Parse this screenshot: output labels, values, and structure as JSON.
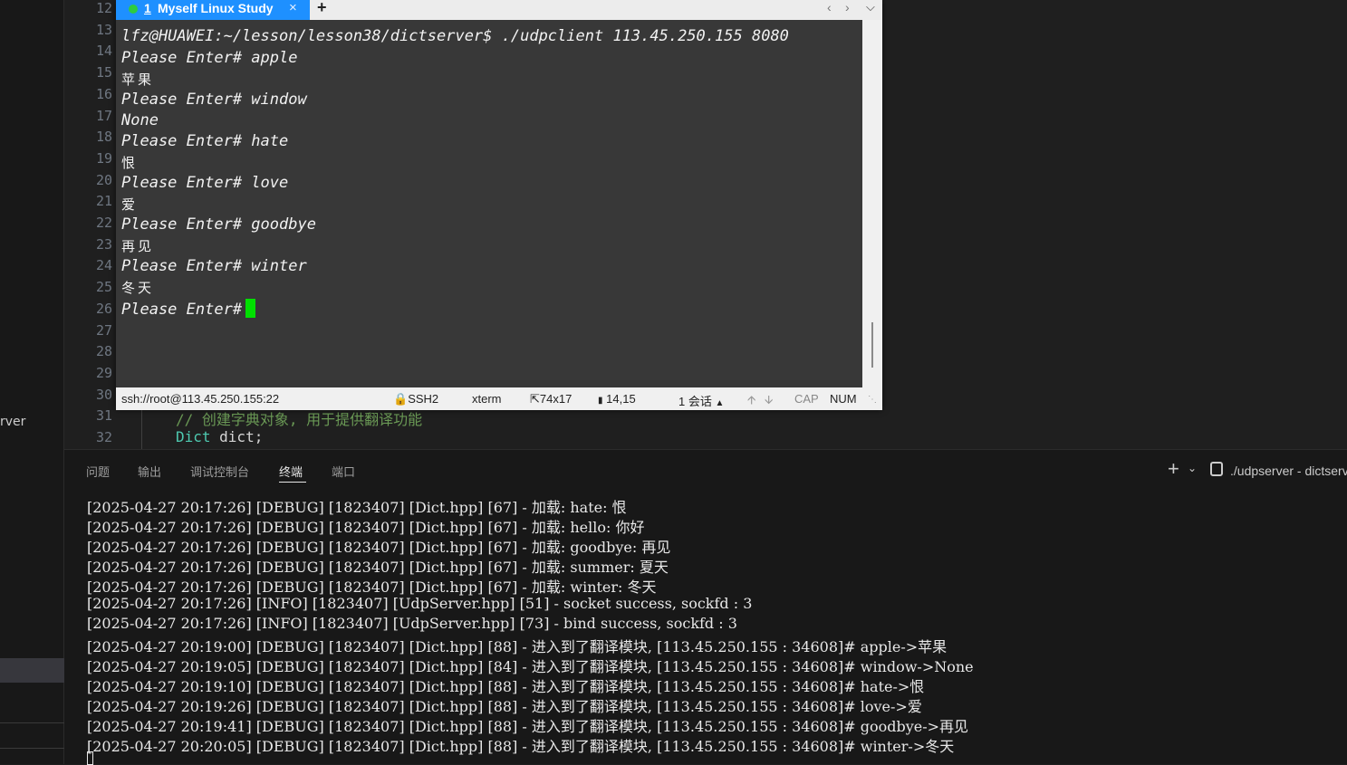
{
  "sidebar": {
    "partial_label": "rver"
  },
  "editor": {
    "line_numbers": [
      "12",
      "13",
      "14",
      "15",
      "16",
      "17",
      "18",
      "19",
      "20",
      "21",
      "22",
      "23",
      "24",
      "25",
      "26",
      "27",
      "28",
      "29",
      "30",
      "31",
      "32"
    ],
    "code": {
      "comment": "// 创建字典对象, 用于提供翻译功能",
      "type_name": "Dict",
      "var_decl": " dict;",
      "comment_color": "#6a9955",
      "type_color": "#4ec9b0",
      "text_color": "#d4d4d4"
    }
  },
  "xshell": {
    "tab": {
      "number": "1",
      "title": "Myself Linux Study",
      "close": "×",
      "add": "+",
      "status_color": "#2ecc40",
      "accent": "#1e90ff"
    },
    "nav": {
      "left": "‹",
      "right": "›",
      "menu": "⌵"
    },
    "terminal": {
      "prompt_line": "lfz@HUAWEI:~/lesson/lesson38/dictserver$ ./udpclient 113.45.250.155 8080",
      "lines": [
        {
          "kind": "input",
          "text": "Please Enter# apple"
        },
        {
          "kind": "output",
          "text": "苹果"
        },
        {
          "kind": "input",
          "text": "Please Enter# window"
        },
        {
          "kind": "input",
          "text": "None"
        },
        {
          "kind": "input",
          "text": "Please Enter# hate"
        },
        {
          "kind": "output",
          "text": "恨"
        },
        {
          "kind": "input",
          "text": "Please Enter# love"
        },
        {
          "kind": "output",
          "text": "爱"
        },
        {
          "kind": "input",
          "text": "Please Enter# goodbye"
        },
        {
          "kind": "output",
          "text": "再见"
        },
        {
          "kind": "input",
          "text": "Please Enter# winter"
        },
        {
          "kind": "output",
          "text": "冬天"
        },
        {
          "kind": "input",
          "text": "Please Enter#"
        }
      ],
      "cursor_color": "#00e000"
    },
    "status": {
      "address": "ssh://root@113.45.250.155:22",
      "protocol": "SSH2",
      "terminal_type": "xterm",
      "size": "74x17",
      "position": "14,15",
      "sessions": "1 会话",
      "caps": "CAP",
      "num": "NUM"
    }
  },
  "panel": {
    "tabs": [
      "问题",
      "输出",
      "调试控制台",
      "终端",
      "端口"
    ],
    "active_tab": "终端",
    "terminal_label": "./udpserver - dictserv",
    "logs": [
      "[2025-04-27 20:17:26] [DEBUG] [1823407] [Dict.hpp] [67] - 加载: hate: 恨",
      "[2025-04-27 20:17:26] [DEBUG] [1823407] [Dict.hpp] [67] - 加载: hello: 你好",
      "[2025-04-27 20:17:26] [DEBUG] [1823407] [Dict.hpp] [67] - 加载: goodbye: 再见",
      "[2025-04-27 20:17:26] [DEBUG] [1823407] [Dict.hpp] [67] - 加载: summer: 夏天",
      "[2025-04-27 20:17:26] [DEBUG] [1823407] [Dict.hpp] [67] - 加载: winter: 冬天",
      "[2025-04-27 20:17:26] [INFO] [1823407] [UdpServer.hpp] [51] - socket success, sockfd : 3",
      "[2025-04-27 20:17:26] [INFO] [1823407] [UdpServer.hpp] [73] - bind success, sockfd : 3",
      "[2025-04-27 20:19:00] [DEBUG] [1823407] [Dict.hpp] [88] - 进入到了翻译模块, [113.45.250.155 : 34608]# apple->苹果",
      "[2025-04-27 20:19:05] [DEBUG] [1823407] [Dict.hpp] [84] - 进入到了翻译模块, [113.45.250.155 : 34608]# window->None",
      "[2025-04-27 20:19:10] [DEBUG] [1823407] [Dict.hpp] [88] - 进入到了翻译模块, [113.45.250.155 : 34608]# hate->恨",
      "[2025-04-27 20:19:26] [DEBUG] [1823407] [Dict.hpp] [88] - 进入到了翻译模块, [113.45.250.155 : 34608]# love->爱",
      "[2025-04-27 20:19:41] [DEBUG] [1823407] [Dict.hpp] [88] - 进入到了翻译模块, [113.45.250.155 : 34608]# goodbye->再见",
      "[2025-04-27 20:20:05] [DEBUG] [1823407] [Dict.hpp] [88] - 进入到了翻译模块, [113.45.250.155 : 34608]# winter->冬天"
    ]
  }
}
